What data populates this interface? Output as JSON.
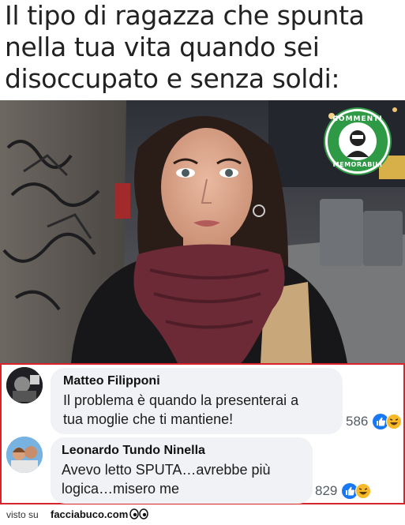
{
  "meme": {
    "caption": "Il tipo di ragazza che spunta\nnella tua vita quando sei\ndisoccupato e senza soldi:"
  },
  "badge": {
    "top_text": "COMMENTI",
    "bottom_text": "MEMORABILI"
  },
  "comments": [
    {
      "author": "Matteo Filipponi",
      "text_line1": "Il problema è quando la presenterai a",
      "text_line2": "tua moglie che ti mantiene!",
      "reaction_count": "586",
      "reactions": [
        "like-icon",
        "haha-icon"
      ]
    },
    {
      "author": "Leonardo Tundo Ninella",
      "text_line1": "Avevo letto SPUTA…avrebbe più",
      "text_line2": "logica…misero me",
      "reaction_count": "829",
      "reactions": [
        "like-icon",
        "haha-icon"
      ]
    }
  ],
  "footer": {
    "prefix": "visto su",
    "site": "facciabuco.com"
  },
  "colors": {
    "panel_border": "#d8232a",
    "bubble": "#f0f2f5",
    "like": "#1877f2",
    "haha": "#f7b928",
    "badge": "#2f9a45"
  }
}
